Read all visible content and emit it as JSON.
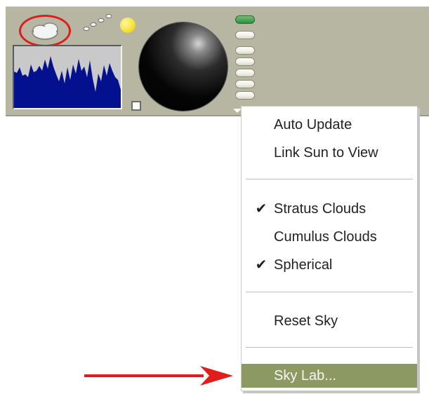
{
  "colors": {
    "toolbar_bg": "#b7b6a3",
    "waveform": "#03118f",
    "highlight_bg": "#8d9962",
    "annotation_red": "#e21b1b",
    "sun_yellow": "#f7e33a",
    "knob_black": "#000000",
    "ladder_active": "#2f8e3d"
  },
  "toolbar": {
    "icons": {
      "cloud": "cloud-icon",
      "sun": "sun-icon",
      "histogram": "sky-histogram",
      "knob": "sky-rotation-knob",
      "ladder": "cloud-layer-ladder"
    }
  },
  "menu": {
    "items": [
      {
        "label": "Auto Update",
        "checked": false
      },
      {
        "label": "Link Sun to View",
        "checked": false
      },
      {
        "label": "Stratus Clouds",
        "checked": true
      },
      {
        "label": "Cumulus Clouds",
        "checked": false
      },
      {
        "label": "Spherical",
        "checked": true
      },
      {
        "label": "Reset Sky",
        "checked": false
      },
      {
        "label": "Sky Lab...",
        "checked": false,
        "highlighted": true
      }
    ],
    "check_glyph": "✔"
  }
}
